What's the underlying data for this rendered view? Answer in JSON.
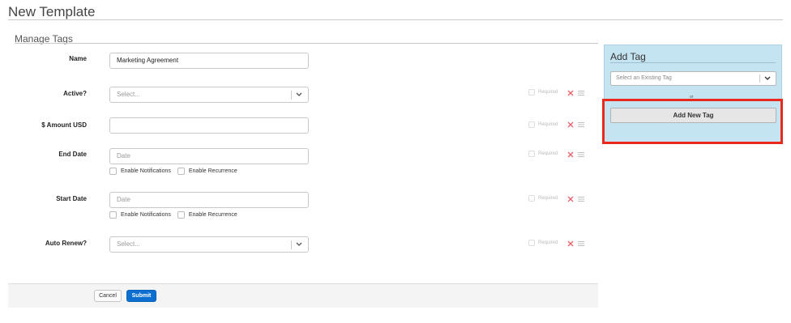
{
  "page": {
    "title": "New Template"
  },
  "section": {
    "title": "Manage Tags"
  },
  "fields": [
    {
      "label": "Name",
      "value": "Marketing Agreement",
      "placeholder": "",
      "type": "text"
    },
    {
      "label": "Active?",
      "value": "",
      "placeholder": "Select...",
      "type": "select",
      "required_label": "Required"
    },
    {
      "label": "$ Amount USD",
      "value": "",
      "placeholder": "",
      "type": "text",
      "required_label": "Required"
    },
    {
      "label": "End Date",
      "value": "",
      "placeholder": "Date",
      "type": "date",
      "required_label": "Required",
      "checkboxes": [
        "Enable Notifications",
        "Enable Recurrence"
      ]
    },
    {
      "label": "Start Date",
      "value": "",
      "placeholder": "Date",
      "type": "date",
      "required_label": "Required",
      "checkboxes": [
        "Enable Notifications",
        "Enable Recurrence"
      ]
    },
    {
      "label": "Auto Renew?",
      "value": "",
      "placeholder": "Select...",
      "type": "select",
      "required_label": "Required"
    }
  ],
  "icons": {
    "remove": "close-icon",
    "reorder": "list-icon",
    "dropdown": "chevron-down-icon"
  },
  "footer": {
    "cancel_label": "Cancel",
    "submit_label": "Submit"
  },
  "add_tag_panel": {
    "title": "Add Tag",
    "select_placeholder": "Select an Existing Tag",
    "or_text": "or",
    "add_new_label": "Add New Tag"
  },
  "colors": {
    "accent": "#0d70d1",
    "panel_bg": "#c5e4f2",
    "remove_icon": "#e8606a",
    "highlight": "#e8291c"
  }
}
